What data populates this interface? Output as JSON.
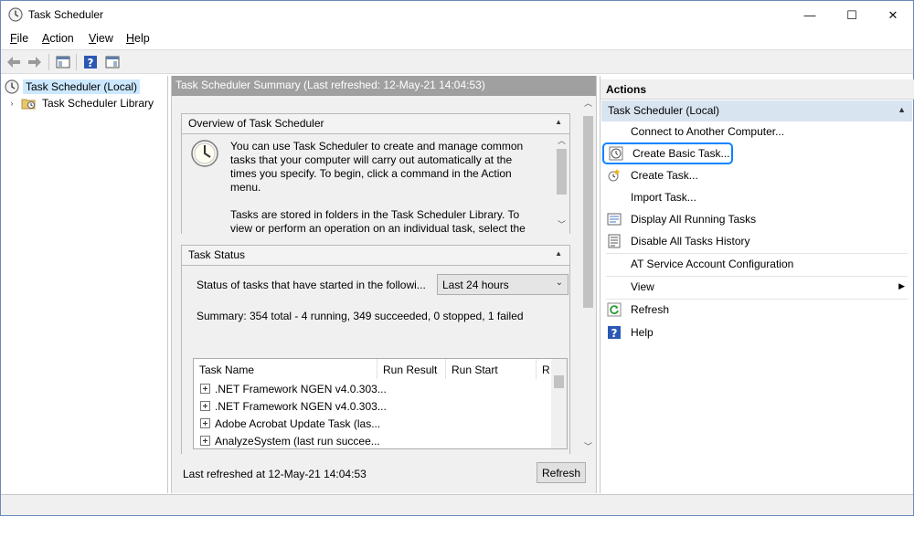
{
  "window": {
    "title": "Task Scheduler",
    "min_glyph": "—",
    "max_glyph": "☐",
    "close_glyph": "✕"
  },
  "menu": {
    "file": {
      "underlined": "F",
      "rest": "ile"
    },
    "action": {
      "underlined": "A",
      "rest": "ction"
    },
    "view": {
      "underlined": "V",
      "rest": "iew"
    },
    "help": {
      "underlined": "H",
      "rest": "elp"
    }
  },
  "tree": {
    "root": "Task Scheduler (Local)",
    "library": "Task Scheduler Library"
  },
  "center": {
    "header": "Task Scheduler Summary (Last refreshed: 12-May-21 14:04:53)",
    "overview": {
      "title": "Overview of Task Scheduler",
      "text1": "You can use Task Scheduler to create and manage common tasks that your computer will carry out automatically at the times you specify. To begin, click a command in the Action menu.",
      "text2": "Tasks are stored in folders in the Task Scheduler Library. To view or perform an operation on an individual task, select the task in"
    },
    "task_status": {
      "title": "Task Status",
      "label": "Status of tasks that have started in the followi...",
      "select_value": "Last 24 hours",
      "summary": "Summary: 354 total - 4 running, 349 succeeded, 0 stopped, 1 failed",
      "columns": [
        "Task Name",
        "Run Result",
        "Run Start",
        "R"
      ],
      "rows": [
        ".NET Framework NGEN v4.0.303...",
        ".NET Framework NGEN v4.0.303...",
        "Adobe Acrobat Update Task (las...",
        "AnalyzeSystem (last run succee..."
      ]
    },
    "footer_text": "Last refreshed at 12-May-21 14:04:53",
    "refresh_label": "Refresh"
  },
  "actions": {
    "title": "Actions",
    "group": "Task Scheduler (Local)",
    "items": [
      {
        "label": "Connect to Another Computer...",
        "icon": "none"
      },
      {
        "label": "Create Basic Task...",
        "icon": "basic-task-icon"
      },
      {
        "label": "Create Task...",
        "icon": "create-task-icon"
      },
      {
        "label": "Import Task...",
        "icon": "none"
      },
      {
        "label": "Display All Running Tasks",
        "icon": "running-tasks-icon"
      },
      {
        "label": "Disable All Tasks History",
        "icon": "history-icon"
      },
      {
        "label": "AT Service Account Configuration",
        "icon": "none"
      },
      {
        "label": "View",
        "icon": "none"
      },
      {
        "label": "Refresh",
        "icon": "refresh-icon"
      },
      {
        "label": "Help",
        "icon": "help-icon"
      }
    ]
  },
  "colors": {
    "highlight_outline": "#0a84ff",
    "selection": "#cce8ff",
    "center_header": "#a0a0a0",
    "actions_group": "#d9e4f1"
  }
}
